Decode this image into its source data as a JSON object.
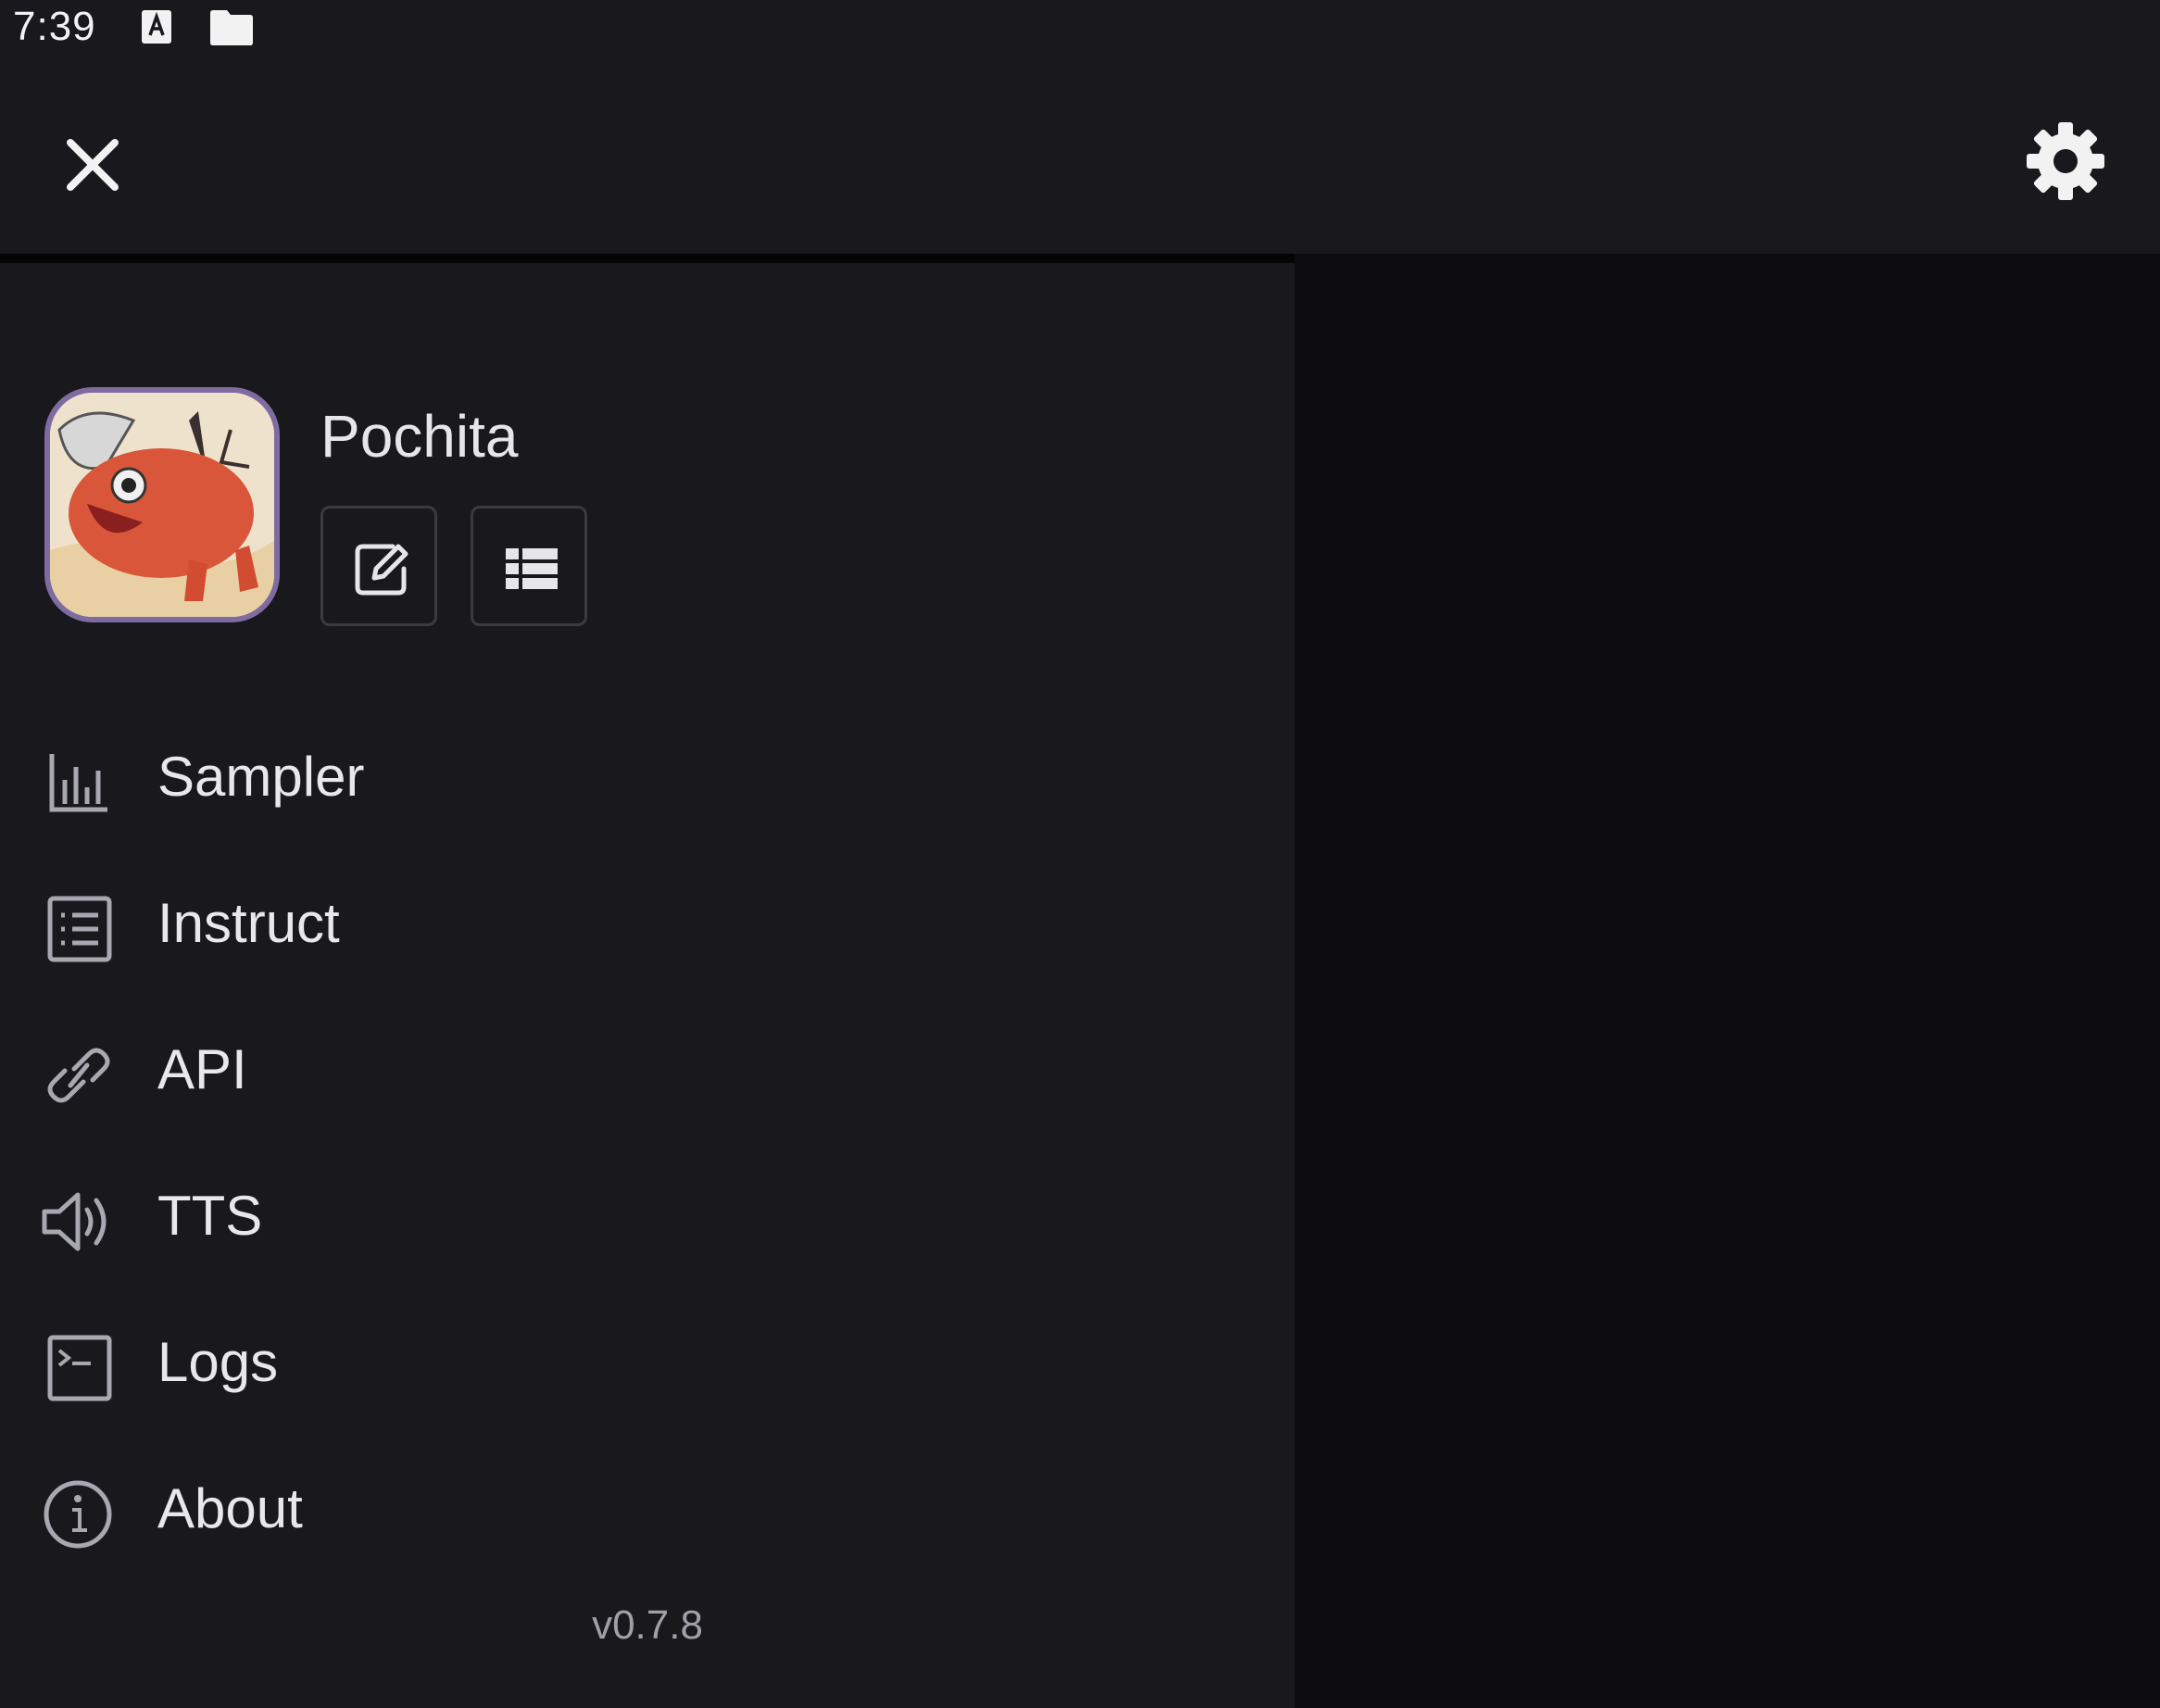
{
  "status_bar": {
    "time": "7:39"
  },
  "header": {
    "close_icon": "close-icon",
    "settings_icon": "gear-icon"
  },
  "character": {
    "name": "Pochita"
  },
  "menu": {
    "items": [
      {
        "label": "Sampler",
        "icon": "bar-chart-icon"
      },
      {
        "label": "Instruct",
        "icon": "list-box-icon"
      },
      {
        "label": "API",
        "icon": "link-icon"
      },
      {
        "label": "TTS",
        "icon": "speaker-icon"
      },
      {
        "label": "Logs",
        "icon": "terminal-icon"
      },
      {
        "label": "About",
        "icon": "info-icon"
      }
    ]
  },
  "footer": {
    "version": "v0.7.8"
  },
  "colors": {
    "background": "#18181d",
    "right_panel": "#0c0c0f",
    "avatar_border": "#7e6ca0",
    "text": "#e6e6ea"
  }
}
